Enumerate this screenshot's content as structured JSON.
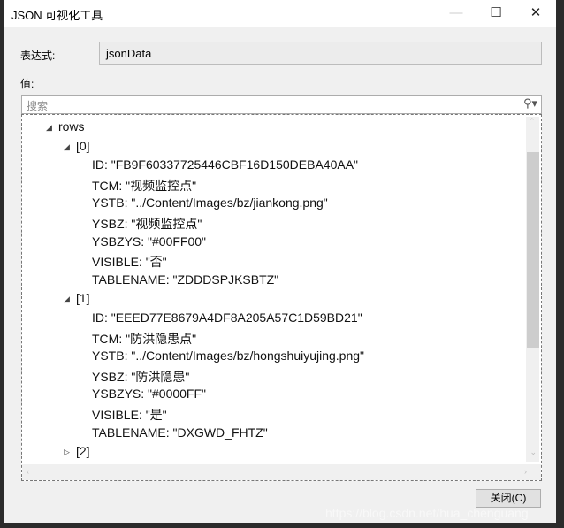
{
  "window": {
    "title": "JSON 可视化工具",
    "minimize": "—",
    "maximize": "☐",
    "close": "✕"
  },
  "expression": {
    "label": "表达式:",
    "value": "jsonData"
  },
  "value_label": "值:",
  "search": {
    "placeholder": "搜索",
    "icon": "search-icon"
  },
  "tree": {
    "root": "rows",
    "items": [
      {
        "label": "[0]",
        "expanded": true,
        "props": [
          "ID: \"FB9F60337725446CBF16D150DEBA40AA\"",
          "TCM: \"视频监控点\"",
          "YSTB: \"../Content/Images/bz/jiankong.png\"",
          "YSBZ: \"视频监控点\"",
          "YSBZYS: \"#00FF00\"",
          "VISIBLE: \"否\"",
          "TABLENAME: \"ZDDDSPJKSBTZ\""
        ]
      },
      {
        "label": "[1]",
        "expanded": true,
        "props": [
          "ID: \"EEED77E8679A4DF8A205A57C1D59BD21\"",
          "TCM: \"防洪隐患点\"",
          "YSTB: \"../Content/Images/bz/hongshuiyujing.png\"",
          "YSBZ: \"防洪隐患\"",
          "YSBZYS: \"#0000FF\"",
          "VISIBLE: \"是\"",
          "TABLENAME: \"DXGWD_FHTZ\""
        ]
      },
      {
        "label": "[2]",
        "expanded": false,
        "props": []
      }
    ]
  },
  "close_button": "关闭(C)",
  "watermark": "https://blog.csdn.net/hua_chenguang"
}
